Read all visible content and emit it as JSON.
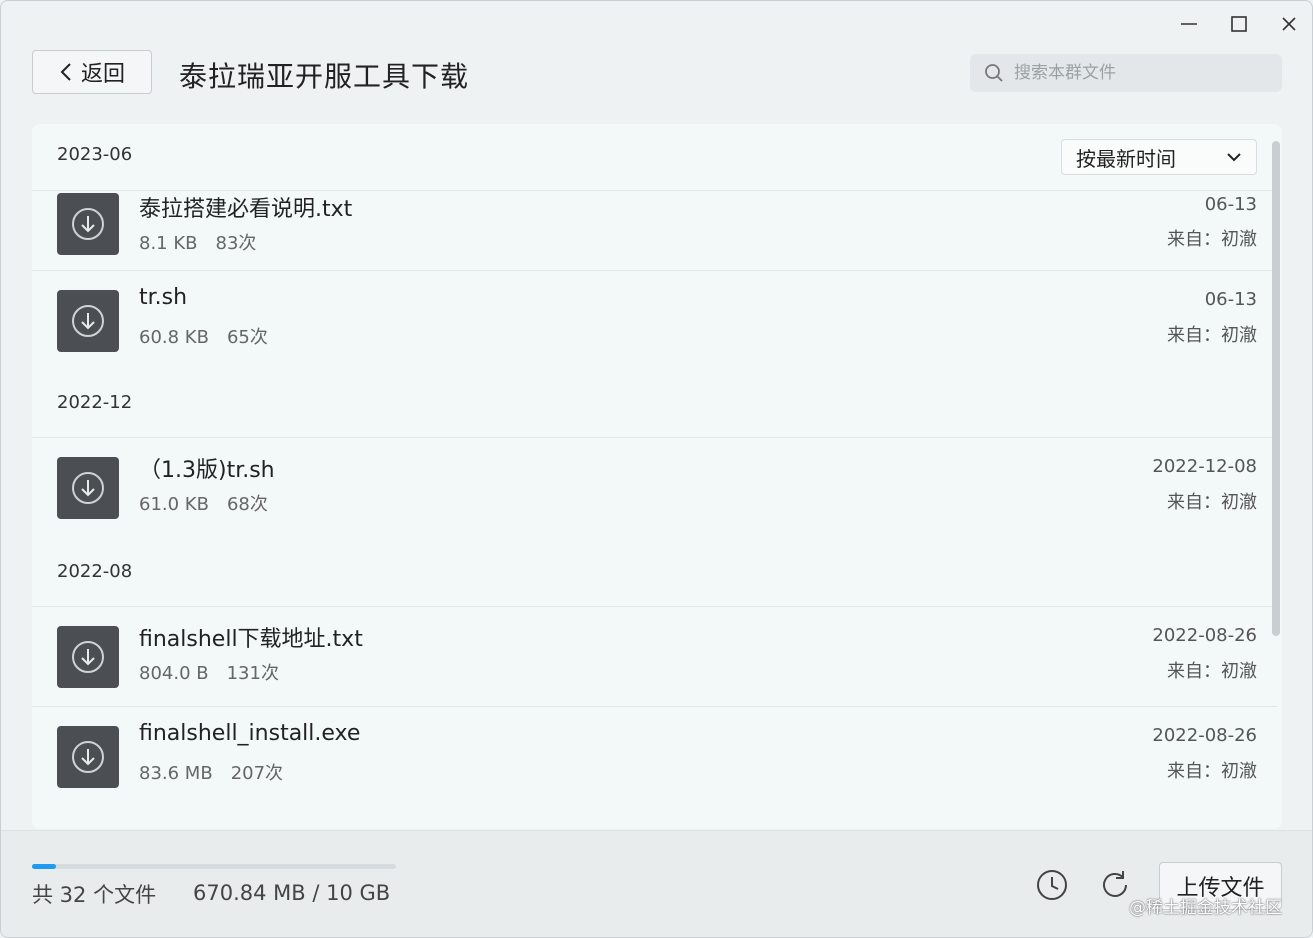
{
  "header": {
    "back_label": "返回",
    "title": "泰拉瑞亚开服工具下载",
    "search_placeholder": "搜索本群文件"
  },
  "sort": {
    "selected": "按最新时间"
  },
  "groups": [
    {
      "label": "2023-06",
      "files": [
        {
          "name": "泰拉搭建必看说明.txt",
          "size": "8.1 KB",
          "downloads": "83次",
          "date": "06-13",
          "source": "来自：初澈"
        },
        {
          "name": "tr.sh",
          "size": "60.8 KB",
          "downloads": "65次",
          "date": "06-13",
          "source": "来自：初澈"
        }
      ]
    },
    {
      "label": "2022-12",
      "files": [
        {
          "name": "（1.3版)tr.sh",
          "size": "61.0 KB",
          "downloads": "68次",
          "date": "2022-12-08",
          "source": "来自：初澈"
        }
      ]
    },
    {
      "label": "2022-08",
      "files": [
        {
          "name": "finalshell下载地址.txt",
          "size": "804.0 B",
          "downloads": "131次",
          "date": "2022-08-26",
          "source": "来自：初澈"
        },
        {
          "name": "finalshell_install.exe",
          "size": "83.6 MB",
          "downloads": "207次",
          "date": "2022-08-26",
          "source": "来自：初澈"
        }
      ]
    }
  ],
  "footer": {
    "file_count": "共 32 个文件",
    "storage": "670.84 MB / 10 GB",
    "storage_fraction": 0.0655,
    "upload_label": "上传文件"
  },
  "watermark": "@稀土掘金技术社区",
  "colors": {
    "accent": "#1e9bf0",
    "file_icon_bg": "#4b4f53",
    "panel_bg": "#f3f8f9",
    "window_bg": "#eef2f3"
  },
  "icons": [
    "minimize-icon",
    "maximize-icon",
    "close-icon",
    "chevron-left-icon",
    "search-icon",
    "chevron-down-icon",
    "download-icon",
    "history-icon",
    "refresh-icon"
  ]
}
